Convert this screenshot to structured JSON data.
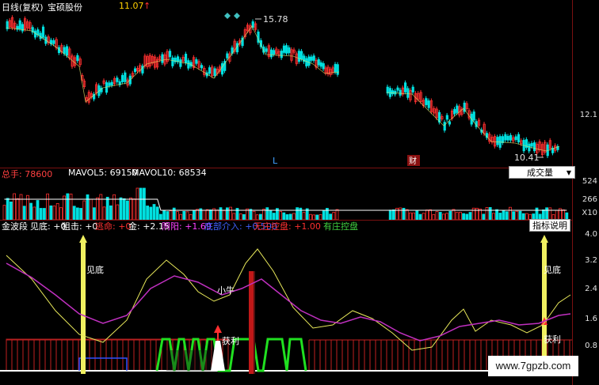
{
  "header": {
    "period_label": "日线(复权)",
    "stock_name": "宝硕股份",
    "price": "11.07",
    "price_arrow": "↑"
  },
  "main_chart": {
    "high_label": "15.78",
    "low_label": "10.41",
    "marker_L": "L",
    "marker_cai": "财"
  },
  "right_axis": {
    "price_tick": "12.1",
    "vol_ticks": [
      "524",
      "266",
      "X10"
    ],
    "ind_ticks": [
      "4.0",
      "3.2",
      "2.4",
      "1.6",
      "0.8"
    ]
  },
  "volume": {
    "total_label": "总手: 78600",
    "ma5_label": "MAVOL5: 69150",
    "ma10_label": "MAVOL10: 68534",
    "dropdown_label": "成交量"
  },
  "indicator": {
    "name": "金波段",
    "items": [
      {
        "text": "见底: +0",
        "color": "#ffffff"
      },
      {
        "text": "狙击: +0",
        "color": "#ffffff"
      },
      {
        "text": "逃命: +0",
        "color": "#ff3030"
      },
      {
        "text": "金: +2.15",
        "color": "#ffffff"
      },
      {
        "text": "阴阳: +1.69",
        "color": "#ff40ff"
      },
      {
        "text": "底部介入: +0.500",
        "color": "#4060ff"
      },
      {
        "text": "无庄控盘: +1.00",
        "color": "#ff3030"
      },
      {
        "text": "有庄控盘",
        "color": "#40d040"
      }
    ],
    "button_label": "指标说明",
    "annotations": {
      "jiandi_left": "见底",
      "jiandi_right": "见底",
      "xiaoniu": "小牛",
      "huoli_mid": "获利",
      "huoli_right": "获利"
    }
  },
  "watermark": "www.7gpzb.com",
  "colors": {
    "up": "#ff3030",
    "down": "#00e0e0",
    "yellow_line": "#e8e85a",
    "magenta_line": "#c030c0",
    "green_band": "#20e020",
    "grid_red": "#7a1010"
  }
}
